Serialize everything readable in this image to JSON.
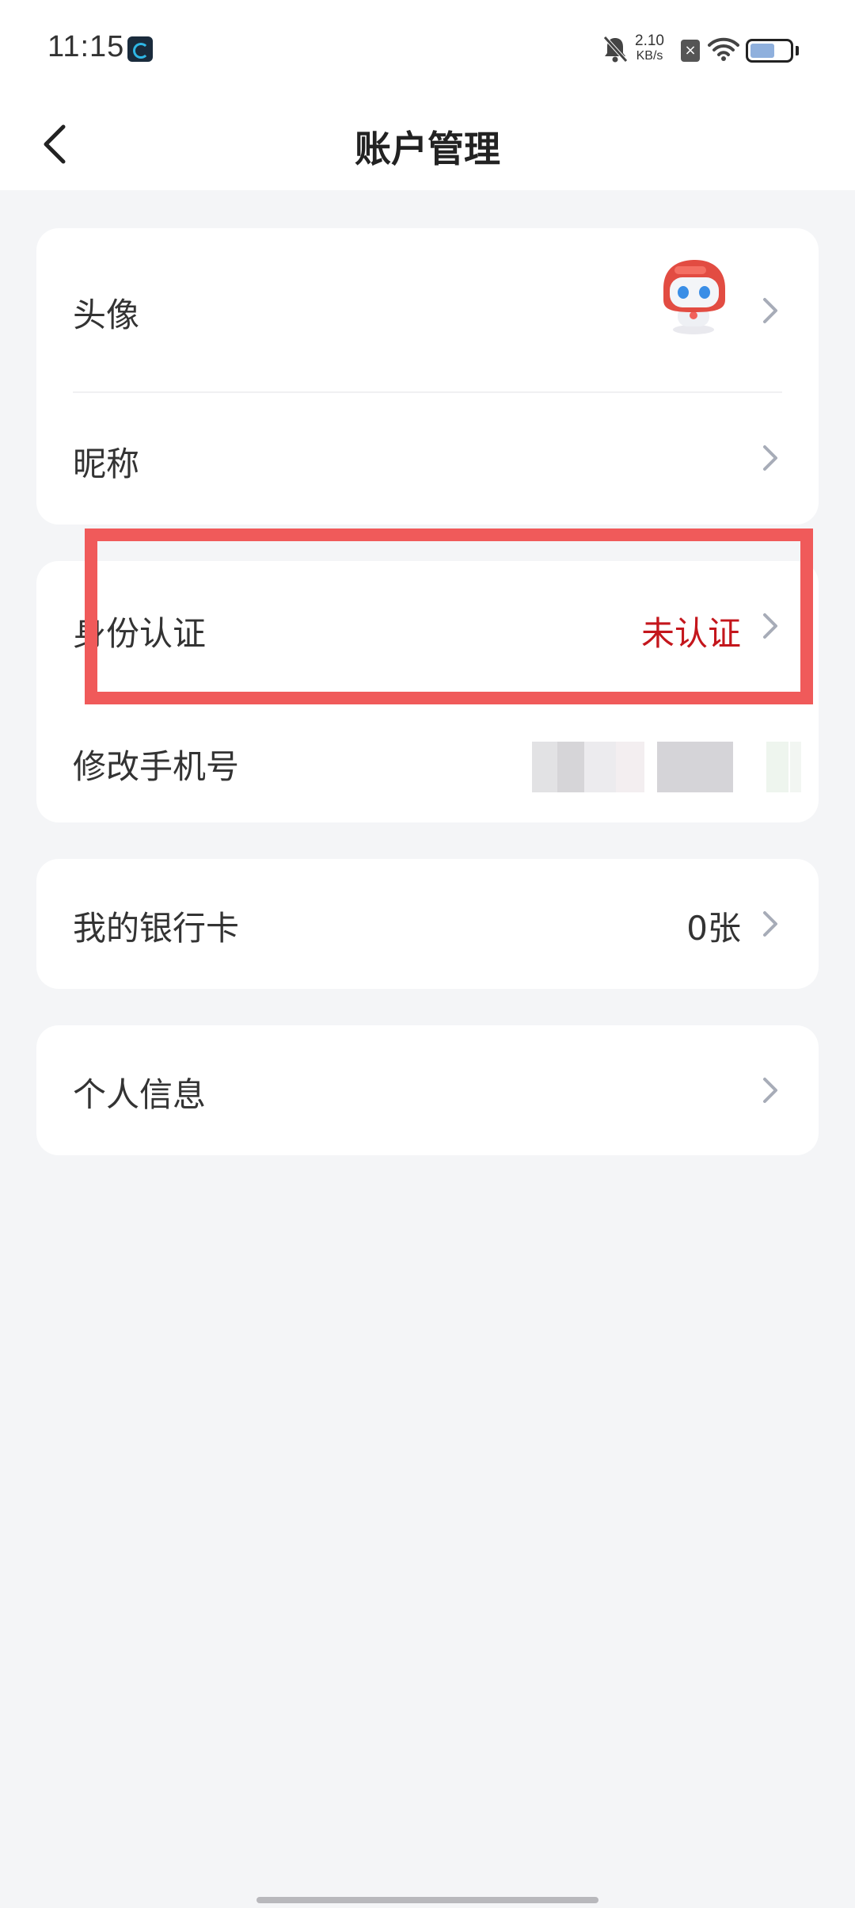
{
  "status_bar": {
    "time": "11:15",
    "net_speed_value": "2.10",
    "net_speed_unit": "KB/s",
    "icons": [
      "app-icon",
      "bell-off-icon",
      "sim-x-icon",
      "wifi-icon",
      "battery-icon"
    ]
  },
  "nav": {
    "title": "账户管理",
    "back_icon": "chevron-left-icon"
  },
  "profile_card": {
    "avatar_label": "头像",
    "nickname_label": "昵称"
  },
  "identity_card": {
    "identity_label": "身份认证",
    "identity_status": "未认证",
    "phone_label": "修改手机号"
  },
  "bank_card": {
    "label": "我的银行卡",
    "count": "0张"
  },
  "personal_card": {
    "label": "个人信息"
  },
  "colors": {
    "accent_red": "#c4161c",
    "highlight_border": "#f05a5a",
    "background": "#f4f5f7"
  }
}
